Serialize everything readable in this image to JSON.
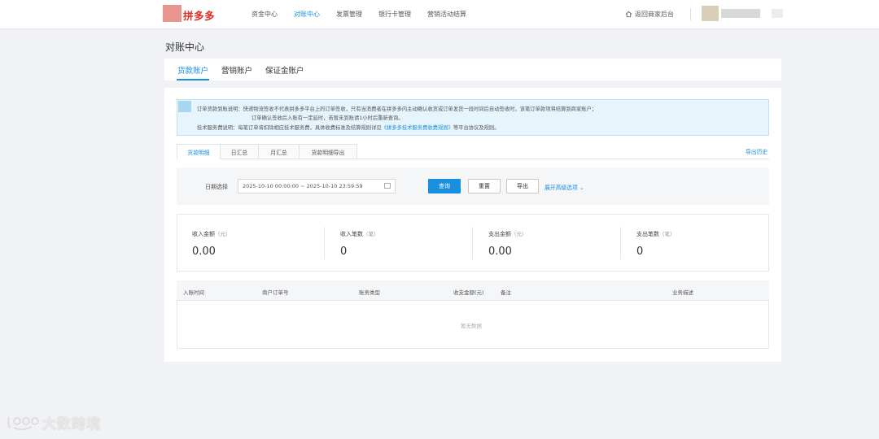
{
  "header": {
    "logo_text": "拼多多",
    "nav": [
      "资金中心",
      "对账中心",
      "发票管理",
      "银行卡管理",
      "营销活动结算"
    ],
    "active_nav_index": 1,
    "back_label": "返回商家后台"
  },
  "page_title": "对账中心",
  "account_tabs": [
    "货款账户",
    "营销账户",
    "保证金账户"
  ],
  "notice": {
    "line1": "订单货款到账说明：快递物流签收不代表拼多多平台上的订单签收，只有当消费者在拼多多内主动确认收货或订单发货一段时间后自动签收时，该笔订单款项将结算到商家账户；",
    "line2": "订单确认签收后入账有一定延时，若暂未到账请1小时后重新查询。",
    "line3_prefix": "技术服务费说明：每笔订单将扣除相应技术服务费，具体收费标准及结算规则详见",
    "line3_link": "《拼多多技术服务费收费规则》",
    "line3_suffix": "等平台协议及规则。"
  },
  "sub_tabs": [
    "货款明细",
    "日汇总",
    "月汇总",
    "货款明细导出"
  ],
  "export_history": "导出历史",
  "filter": {
    "date_label": "日期选择",
    "date_range": "2025-10-10 00:00:00 ~ 2025-10-10 23:59:59",
    "query": "查询",
    "reset": "重置",
    "export": "导出",
    "advanced": "展开高级选项"
  },
  "stats": [
    {
      "label": "收入金额",
      "unit": "（元）",
      "value": "0.00"
    },
    {
      "label": "收入笔数",
      "unit": "（笔）",
      "value": "0"
    },
    {
      "label": "支出金额",
      "unit": "（元）",
      "value": "0.00"
    },
    {
      "label": "支出笔数",
      "unit": "（笔）",
      "value": "0"
    }
  ],
  "table": {
    "columns": [
      "入账时间",
      "商户订单号",
      "账务类型",
      "收支金额(元)",
      "备注",
      "业务描述"
    ],
    "empty_text": "暂无数据"
  },
  "watermark": "大数跨境",
  "colors": {
    "accent": "#1a8fe0",
    "brand": "#e02e24"
  }
}
